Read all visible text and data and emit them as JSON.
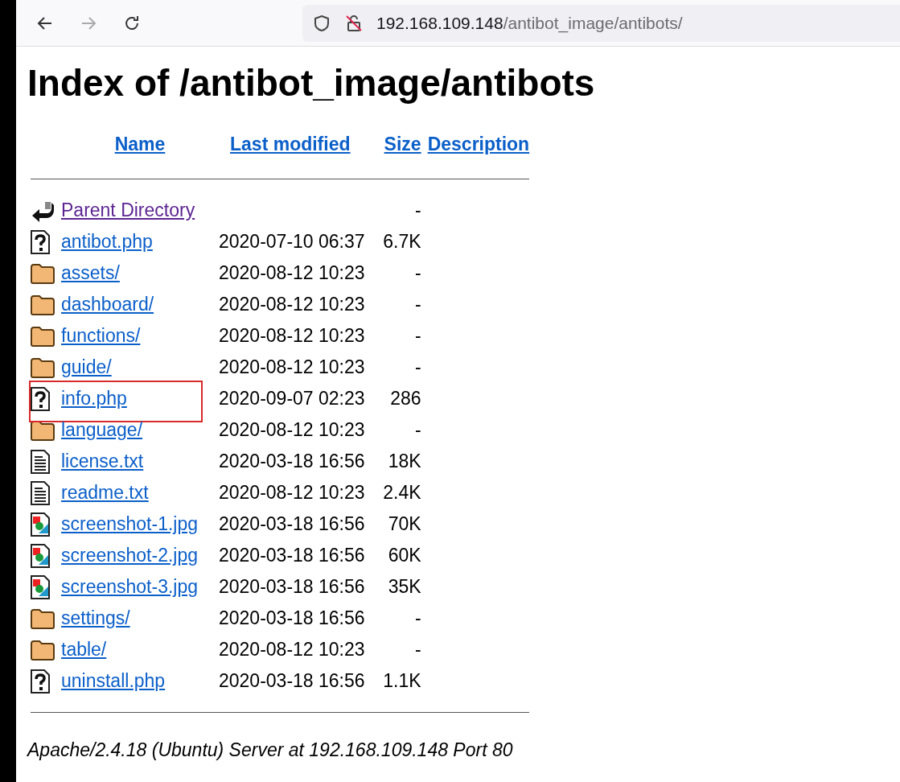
{
  "browser": {
    "url_host": "192.168.109.148",
    "url_path": "/antibot_image/antibots/"
  },
  "page": {
    "title": "Index of /antibot_image/antibots",
    "columns": [
      "Name",
      "Last modified",
      "Size",
      "Description"
    ],
    "rows": [
      {
        "kind": "back",
        "name": "Parent Directory",
        "modified": "",
        "size": "-",
        "visited": true,
        "highlighted": false
      },
      {
        "kind": "unknown",
        "name": "antibot.php",
        "modified": "2020-07-10 06:37",
        "size": "6.7K",
        "visited": false,
        "highlighted": false
      },
      {
        "kind": "folder",
        "name": "assets/",
        "modified": "2020-08-12 10:23",
        "size": "-",
        "visited": false,
        "highlighted": false
      },
      {
        "kind": "folder",
        "name": "dashboard/",
        "modified": "2020-08-12 10:23",
        "size": "-",
        "visited": false,
        "highlighted": false
      },
      {
        "kind": "folder",
        "name": "functions/",
        "modified": "2020-08-12 10:23",
        "size": "-",
        "visited": false,
        "highlighted": false
      },
      {
        "kind": "folder",
        "name": "guide/",
        "modified": "2020-08-12 10:23",
        "size": "-",
        "visited": false,
        "highlighted": false
      },
      {
        "kind": "unknown",
        "name": "info.php",
        "modified": "2020-09-07 02:23",
        "size": "286",
        "visited": false,
        "highlighted": true
      },
      {
        "kind": "folder",
        "name": "language/",
        "modified": "2020-08-12 10:23",
        "size": "-",
        "visited": false,
        "highlighted": false
      },
      {
        "kind": "text",
        "name": "license.txt",
        "modified": "2020-03-18 16:56",
        "size": "18K",
        "visited": false,
        "highlighted": false
      },
      {
        "kind": "text",
        "name": "readme.txt",
        "modified": "2020-08-12 10:23",
        "size": "2.4K",
        "visited": false,
        "highlighted": false
      },
      {
        "kind": "image",
        "name": "screenshot-1.jpg",
        "modified": "2020-03-18 16:56",
        "size": "70K",
        "visited": false,
        "highlighted": false
      },
      {
        "kind": "image",
        "name": "screenshot-2.jpg",
        "modified": "2020-03-18 16:56",
        "size": "60K",
        "visited": false,
        "highlighted": false
      },
      {
        "kind": "image",
        "name": "screenshot-3.jpg",
        "modified": "2020-03-18 16:56",
        "size": "35K",
        "visited": false,
        "highlighted": false
      },
      {
        "kind": "folder",
        "name": "settings/",
        "modified": "2020-03-18 16:56",
        "size": "-",
        "visited": false,
        "highlighted": false
      },
      {
        "kind": "folder",
        "name": "table/",
        "modified": "2020-08-12 10:23",
        "size": "-",
        "visited": false,
        "highlighted": false
      },
      {
        "kind": "unknown",
        "name": "uninstall.php",
        "modified": "2020-03-18 16:56",
        "size": "1.1K",
        "visited": false,
        "highlighted": false
      }
    ],
    "footer": "Apache/2.4.18 (Ubuntu) Server at 192.168.109.148 Port 80"
  }
}
